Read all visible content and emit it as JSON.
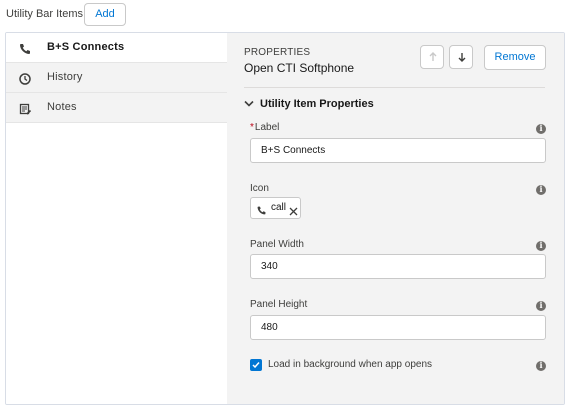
{
  "header": {
    "title": "Utility Bar Items",
    "add_label": "Add"
  },
  "sidebar": {
    "items": [
      {
        "label": "B+S Connects",
        "icon": "phone-icon",
        "active": true
      },
      {
        "label": "History",
        "icon": "clock-icon",
        "active": false
      },
      {
        "label": "Notes",
        "icon": "note-icon",
        "active": false
      }
    ]
  },
  "properties": {
    "eyebrow": "PROPERTIES",
    "title": "Open CTI Softphone",
    "move_up_icon": "arrow-up-icon",
    "move_down_icon": "arrow-down-icon",
    "remove_label": "Remove",
    "section_title": "Utility Item Properties",
    "label_field": {
      "label": "Label",
      "required_marker": "*",
      "value": "B+S Connects"
    },
    "icon_field": {
      "label": "Icon",
      "value": "call"
    },
    "panel_width": {
      "label": "Panel Width",
      "value": "340"
    },
    "panel_height": {
      "label": "Panel Height",
      "value": "480"
    },
    "load_background": {
      "label": "Load in background when app opens",
      "checked": true
    }
  },
  "colors": {
    "accent": "#0176d3",
    "panel_bg": "#f3f3f3",
    "border": "#c9c9c9",
    "required": "#ba0517"
  }
}
